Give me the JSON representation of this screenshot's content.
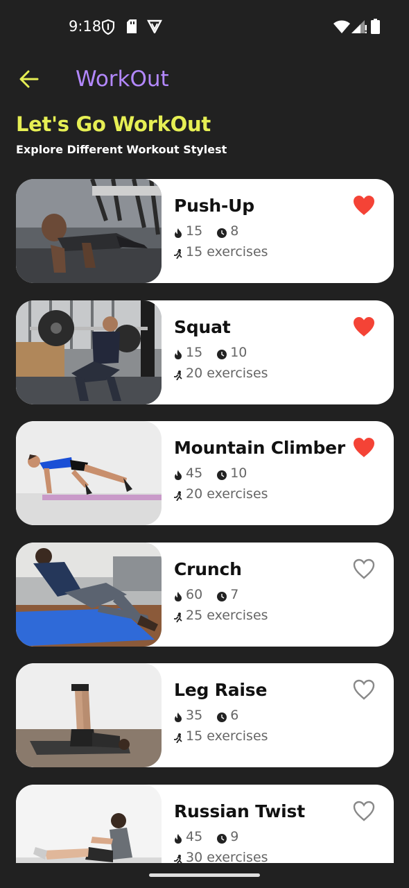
{
  "status_bar": {
    "time": "9:18"
  },
  "app_bar": {
    "title": "WorkOut"
  },
  "header": {
    "heading": "Let's Go WorkOut",
    "subheading": "Explore Different Workout Stylest"
  },
  "colors": {
    "background": "#212121",
    "accent_title": "#b388ff",
    "heading": "#e6ef54",
    "favorite_active": "#f44336",
    "favorite_inactive": "#888888"
  },
  "workouts": [
    {
      "name": "Push-Up",
      "calories": "15",
      "minutes": "8",
      "exercises": "15 exercises",
      "favorite": true,
      "icon": "push-up-photo"
    },
    {
      "name": "Squat",
      "calories": "15",
      "minutes": "10",
      "exercises": "20 exercises",
      "favorite": true,
      "icon": "squat-photo"
    },
    {
      "name": "Mountain Climber",
      "calories": "45",
      "minutes": "10",
      "exercises": "20 exercises",
      "favorite": true,
      "icon": "mountain-climber-photo"
    },
    {
      "name": "Crunch",
      "calories": "60",
      "minutes": "7",
      "exercises": "25 exercises",
      "favorite": false,
      "icon": "crunch-photo"
    },
    {
      "name": "Leg Raise",
      "calories": "35",
      "minutes": "6",
      "exercises": "15 exercises",
      "favorite": false,
      "icon": "leg-raise-photo"
    },
    {
      "name": "Russian Twist",
      "calories": "45",
      "minutes": "9",
      "exercises": "30 exercises",
      "favorite": false,
      "icon": "russian-twist-photo"
    }
  ]
}
